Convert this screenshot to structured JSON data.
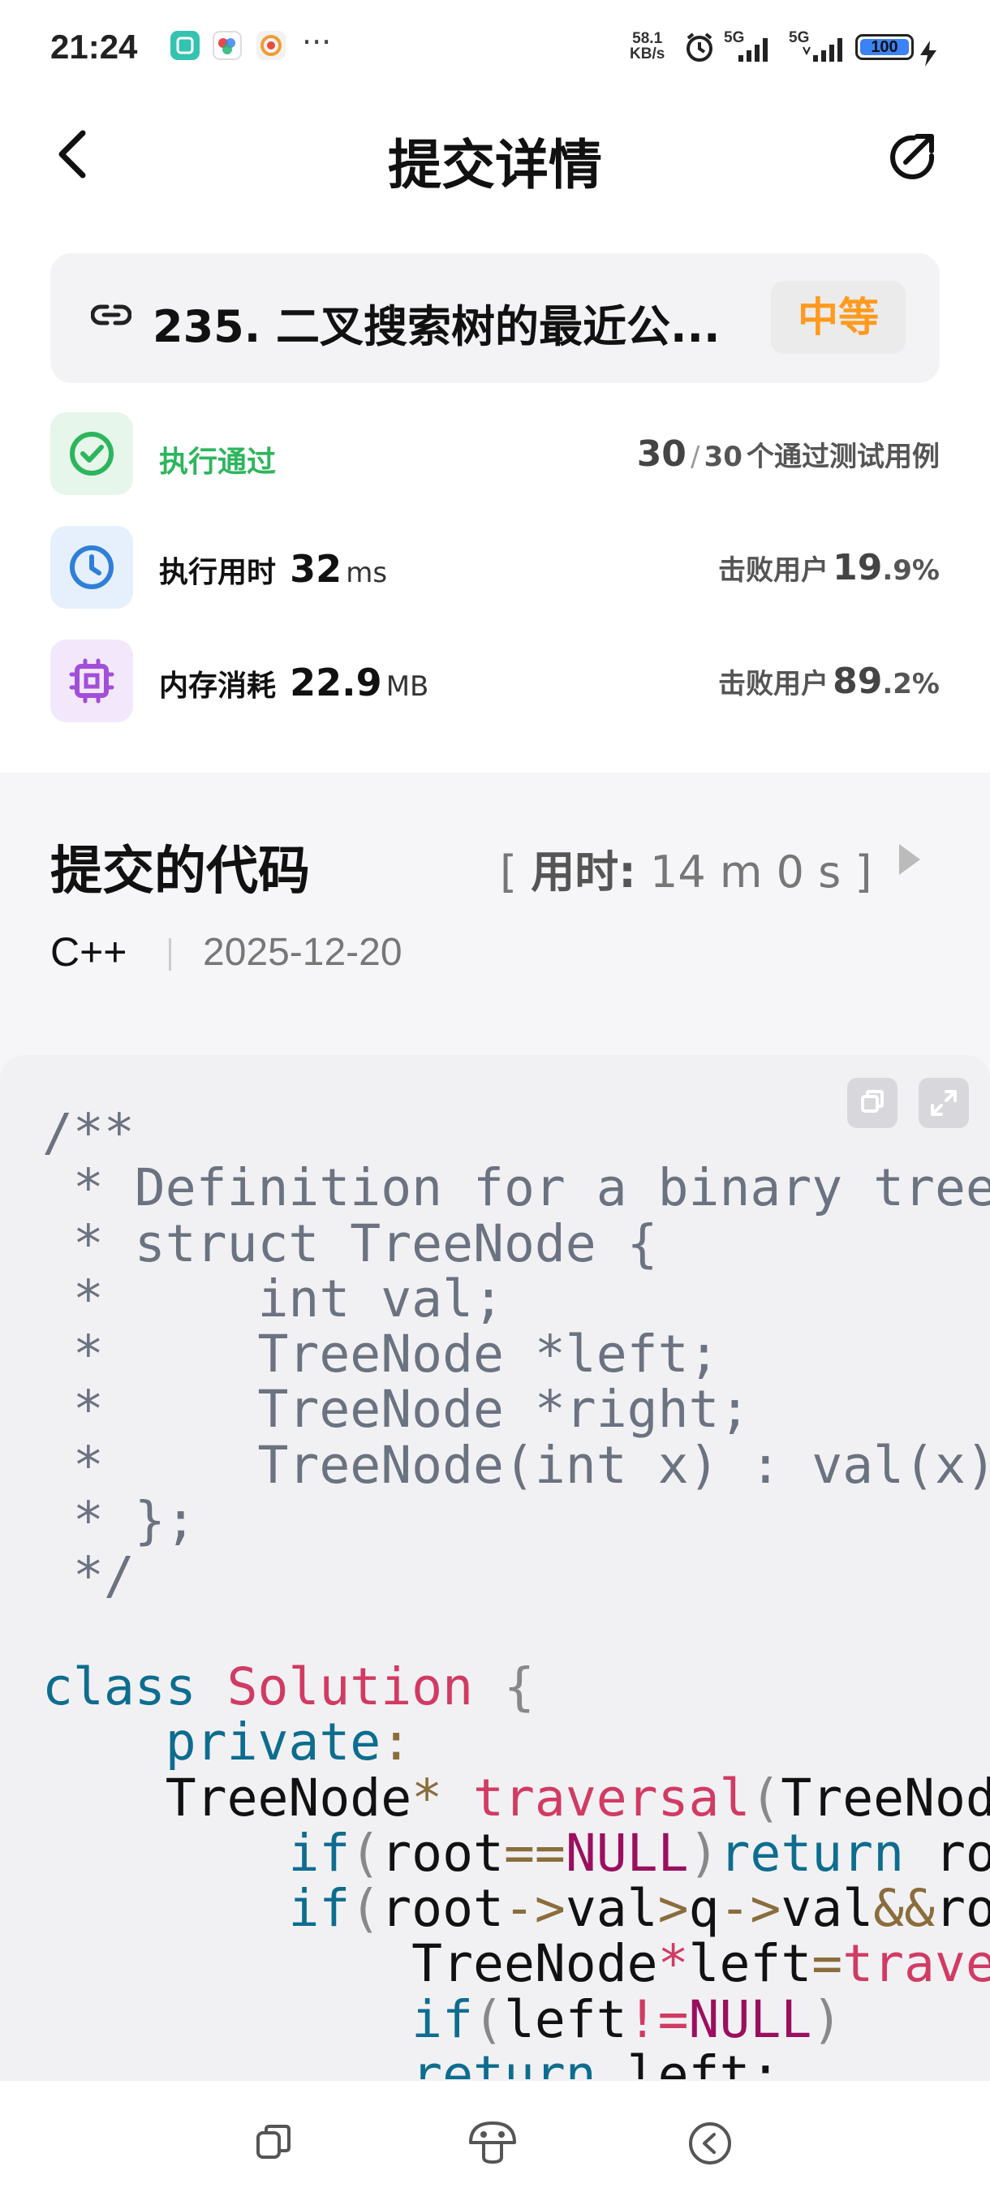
{
  "status_bar": {
    "time": "21:24",
    "more": "···",
    "net_speed_value": "58.1",
    "net_speed_unit": "KB/s",
    "signal_1": "5G",
    "signal_2": "5G",
    "battery": "100"
  },
  "header": {
    "title": "提交详情"
  },
  "problem": {
    "title": "235. 二叉搜索树的最近公...",
    "difficulty": "中等",
    "difficulty_color": "#ff9a1e"
  },
  "result": {
    "status": "执行通过",
    "status_color": "#2db55d",
    "passed": "30",
    "sep": "/",
    "total": "30",
    "cases_label": "个通过测试用例"
  },
  "runtime": {
    "label": "执行用时",
    "value": "32",
    "unit": "ms",
    "beats_label": "击败用户",
    "beats_int": "19",
    "beats_dec": ".9%"
  },
  "memory": {
    "label": "内存消耗",
    "value": "22.9",
    "unit": "MB",
    "beats_label": "击败用户",
    "beats_int": "89",
    "beats_dec": ".2%"
  },
  "code_section": {
    "title": "提交的代码",
    "elapsed_open": "[ ",
    "elapsed_label": "用时:",
    "elapsed_value": " 14 m 0 s ]",
    "language": "C++",
    "date": "2025-12-20"
  },
  "code": {
    "l1": "/**",
    "l2": " * Definition for a binary tree node.",
    "l3": " * struct TreeNode {",
    "l4": " *     int val;",
    "l5": " *     TreeNode *left;",
    "l6": " *     TreeNode *right;",
    "l7": " *     TreeNode(int x) : val(x), left(NULL), right(NULL) {}",
    "l8": " * };",
    "l9": " */",
    "l11_kw": "class",
    "l11_cls": "Solution",
    "l11_brace": "{",
    "l12_kw": "private",
    "l12_colon": ":",
    "l13_type": "TreeNode",
    "l13_star": "*",
    "l13_fn": "traversal",
    "l13_paren": "(",
    "l13_rest": "TreeNode",
    "l14_kw": "if",
    "l14_p1": "(",
    "l14_a": "root",
    "l14_op": "==",
    "l14_const": "NULL",
    "l14_p2": ")",
    "l14_ret": "return",
    "l14_rest": " root;",
    "l15_kw": "if",
    "l15_p1": "(",
    "l15_a": "root",
    "l15_op1": "->",
    "l15_b": "val",
    "l15_op2": ">",
    "l15_c": "q",
    "l15_op3": "->",
    "l15_d": "val",
    "l15_op4": "&&",
    "l15_e": "root",
    "l16_type": "TreeNode",
    "l16_star": "*",
    "l16_var": "left",
    "l16_eq": "=",
    "l16_fn": "traversal",
    "l17_kw": "if",
    "l17_p1": "(",
    "l17_a": "left",
    "l17_op": "!=",
    "l17_const": "NULL",
    "l17_p2": ")",
    "l18_kw": "return",
    "l18_rest": " left;"
  }
}
